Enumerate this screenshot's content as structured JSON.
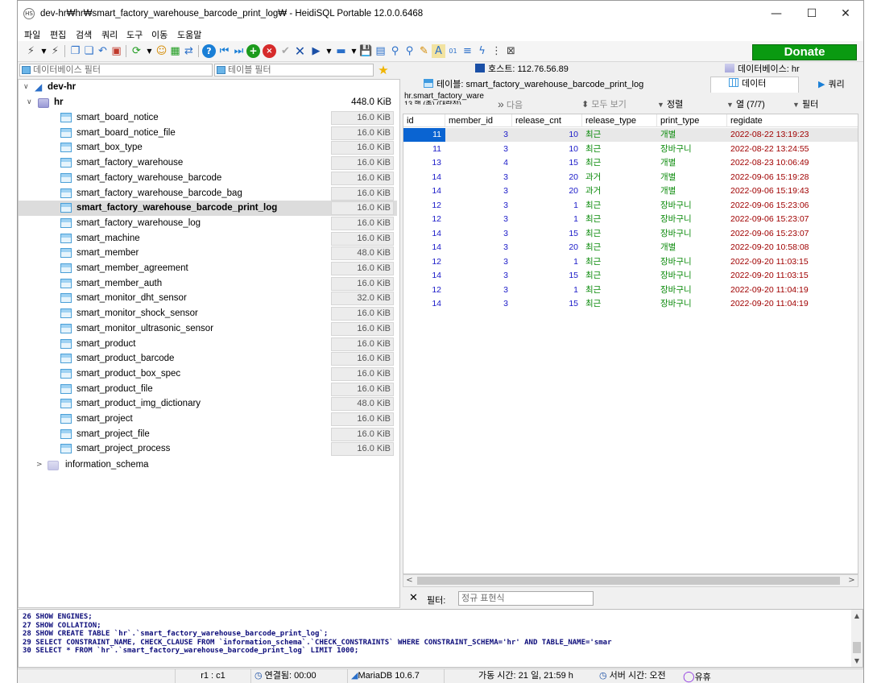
{
  "window": {
    "title": "dev-hr₩hr₩smart_factory_warehouse_barcode_print_log₩ - HeidiSQL Portable 12.0.0.6468",
    "app_icon": "HS",
    "minimize": "—",
    "maximize": "☐",
    "close": "✕"
  },
  "menu": [
    "파일",
    "편집",
    "검색",
    "쿼리",
    "도구",
    "이동",
    "도움말"
  ],
  "toolbar": {
    "donate_label": "Donate",
    "icons": [
      "connect-icon",
      "dropdown-icon",
      "disconnect-icon",
      "copy-icon",
      "paste-icon",
      "undo-icon",
      "print-icon",
      "refresh-icon",
      "dropdown-icon",
      "user-manager-icon",
      "export-icon",
      "transfer-icon",
      "help-icon",
      "first-record-icon",
      "last-record-icon",
      "add-record-icon",
      "delete-record-icon",
      "post-icon",
      "cancel-icon",
      "run-icon",
      "dropdown-icon",
      "run-selection-icon",
      "dropdown-icon",
      "save-icon",
      "load-icon",
      "find-icon",
      "replace-icon",
      "clear-icon",
      "format-icon",
      "binary-icon",
      "wrap-icon",
      "explain-icon",
      "more-icon",
      "close-tab-icon"
    ]
  },
  "left": {
    "db_filter_placeholder": "데이터베이스 필터",
    "table_filter_placeholder": "테이블 필터",
    "connection": "dev-hr",
    "database": "hr",
    "database_size": "448.0 KiB",
    "tables": [
      {
        "name": "smart_board_notice",
        "size": "16.0 KiB"
      },
      {
        "name": "smart_board_notice_file",
        "size": "16.0 KiB"
      },
      {
        "name": "smart_box_type",
        "size": "16.0 KiB"
      },
      {
        "name": "smart_factory_warehouse",
        "size": "16.0 KiB"
      },
      {
        "name": "smart_factory_warehouse_barcode",
        "size": "16.0 KiB"
      },
      {
        "name": "smart_factory_warehouse_barcode_bag",
        "size": "16.0 KiB"
      },
      {
        "name": "smart_factory_warehouse_barcode_print_log",
        "size": "16.0 KiB",
        "selected": true
      },
      {
        "name": "smart_factory_warehouse_log",
        "size": "16.0 KiB"
      },
      {
        "name": "smart_machine",
        "size": "16.0 KiB"
      },
      {
        "name": "smart_member",
        "size": "48.0 KiB"
      },
      {
        "name": "smart_member_agreement",
        "size": "16.0 KiB"
      },
      {
        "name": "smart_member_auth",
        "size": "16.0 KiB"
      },
      {
        "name": "smart_monitor_dht_sensor",
        "size": "32.0 KiB"
      },
      {
        "name": "smart_monitor_shock_sensor",
        "size": "16.0 KiB"
      },
      {
        "name": "smart_monitor_ultrasonic_sensor",
        "size": "16.0 KiB"
      },
      {
        "name": "smart_product",
        "size": "16.0 KiB"
      },
      {
        "name": "smart_product_barcode",
        "size": "16.0 KiB"
      },
      {
        "name": "smart_product_box_spec",
        "size": "16.0 KiB"
      },
      {
        "name": "smart_product_file",
        "size": "16.0 KiB"
      },
      {
        "name": "smart_product_img_dictionary",
        "size": "48.0 KiB"
      },
      {
        "name": "smart_project",
        "size": "16.0 KiB"
      },
      {
        "name": "smart_project_file",
        "size": "16.0 KiB"
      },
      {
        "name": "smart_project_process",
        "size": "16.0 KiB"
      }
    ],
    "other_db": "information_schema"
  },
  "right": {
    "tab_host": "호스트: 112.76.56.89",
    "tab_database": "데이터베이스: hr",
    "tab_table": "테이블: smart_factory_warehouse_barcode_print_log",
    "tab_data": "데이터",
    "tab_query": "쿼리",
    "grid_caption_1": "hr.smart_factory_ware",
    "grid_caption_2": "13 행 (총) (대략적)",
    "next_label": "다음",
    "show_all_label": "모두 보기",
    "sort_label": "정렬",
    "columns_label": "열 (7/7)",
    "filter_label": "필터",
    "columns": [
      "id",
      "member_id",
      "release_cnt",
      "release_type",
      "print_type",
      "regidate"
    ],
    "rows": [
      [
        "11",
        "3",
        "10",
        "최근",
        "개별",
        "2022-08-22 13:19:23"
      ],
      [
        "11",
        "3",
        "10",
        "최근",
        "장바구니",
        "2022-08-22 13:24:55"
      ],
      [
        "13",
        "4",
        "15",
        "최근",
        "개별",
        "2022-08-23 10:06:49"
      ],
      [
        "14",
        "3",
        "20",
        "과거",
        "개별",
        "2022-09-06 15:19:28"
      ],
      [
        "14",
        "3",
        "20",
        "과거",
        "개별",
        "2022-09-06 15:19:43"
      ],
      [
        "12",
        "3",
        "1",
        "최근",
        "장바구니",
        "2022-09-06 15:23:06"
      ],
      [
        "12",
        "3",
        "1",
        "최근",
        "장바구니",
        "2022-09-06 15:23:07"
      ],
      [
        "14",
        "3",
        "15",
        "최근",
        "장바구니",
        "2022-09-06 15:23:07"
      ],
      [
        "14",
        "3",
        "20",
        "최근",
        "개별",
        "2022-09-20 10:58:08"
      ],
      [
        "12",
        "3",
        "1",
        "최근",
        "장바구니",
        "2022-09-20 11:03:15"
      ],
      [
        "14",
        "3",
        "15",
        "최근",
        "장바구니",
        "2022-09-20 11:03:15"
      ],
      [
        "12",
        "3",
        "1",
        "최근",
        "장바구니",
        "2022-09-20 11:04:19"
      ],
      [
        "14",
        "3",
        "15",
        "최근",
        "장바구니",
        "2022-09-20 11:04:19"
      ]
    ],
    "filter_bar_label": "필터:",
    "filter_bar_placeholder": "정규 표현식"
  },
  "sql_log": [
    {
      "n": "26",
      "text": "SHOW ENGINES;"
    },
    {
      "n": "27",
      "text": "SHOW COLLATION;"
    },
    {
      "n": "28",
      "text": "SHOW CREATE TABLE `hr`.`smart_factory_warehouse_barcode_print_log`;"
    },
    {
      "n": "29",
      "text": "SELECT CONSTRAINT_NAME, CHECK_CLAUSE FROM `information_schema`.`CHECK_CONSTRAINTS` WHERE CONSTRAINT_SCHEMA='hr' AND TABLE_NAME='smar"
    },
    {
      "n": "30",
      "text": "SELECT * FROM `hr`.`smart_factory_warehouse_barcode_print_log` LIMIT 1000;"
    }
  ],
  "status": {
    "position": "r1 : c1",
    "connected": "연결됨: 00:00",
    "server": "MariaDB 10.6.7",
    "uptime": "가동 시간: 21 일, 21:59 h",
    "server_time": "서버 시간: 오전",
    "idle": "유휴"
  }
}
